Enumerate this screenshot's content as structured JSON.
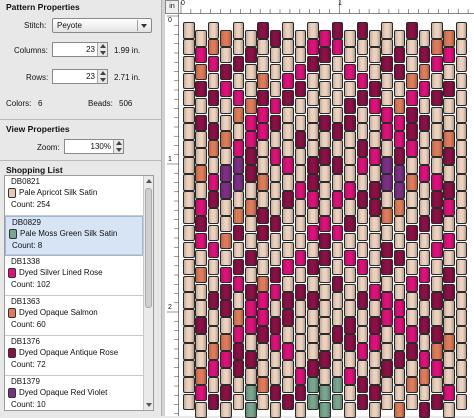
{
  "pattern_properties": {
    "title": "Pattern Properties",
    "stitch_label": "Stitch:",
    "stitch_value": "Peyote",
    "columns_label": "Columns:",
    "columns_value": "23",
    "columns_size": "1.99 in.",
    "rows_label": "Rows:",
    "rows_value": "23",
    "rows_size": "2.71 in.",
    "colors_label": "Colors:",
    "colors_value": "6",
    "beads_label": "Beads:",
    "beads_value": "506"
  },
  "view_properties": {
    "title": "View Properties",
    "zoom_label": "Zoom:",
    "zoom_value": "130%"
  },
  "shopping_list": {
    "title": "Shopping List",
    "items": [
      {
        "code": "DB0821",
        "name": "Pale Apricot Silk Satin",
        "count": "Count: 254",
        "color": "#e8c9b4"
      },
      {
        "code": "DB0829",
        "name": "Pale Moss Green Silk Satin",
        "count": "Count: 8",
        "color": "#78a68e"
      },
      {
        "code": "DB1338",
        "name": "Dyed Silver Lined Rose",
        "count": "Count: 102",
        "color": "#e0107a"
      },
      {
        "code": "DB1363",
        "name": "Dyed Opaque Salmon",
        "count": "Count: 60",
        "color": "#e07b5a"
      },
      {
        "code": "DB1376",
        "name": "Dyed Opaque Antique Rose",
        "count": "Count: 72",
        "color": "#8c1045"
      },
      {
        "code": "DB1379",
        "name": "Dyed Opaque Red Violet",
        "count": "Count: 10",
        "color": "#7d2f86"
      }
    ]
  },
  "ruler": {
    "inch_button": "in",
    "h_marks": [
      "0",
      "1"
    ],
    "v_marks": [
      "0",
      "1",
      "2"
    ]
  },
  "palette": {
    "apricot": "#ecd2be",
    "green": "#78a68e",
    "rose": "#e0107a",
    "salmon": "#e07b5a",
    "antique": "#8c1045",
    "violet": "#7d2f86",
    "selection": "#d7e4f5"
  }
}
